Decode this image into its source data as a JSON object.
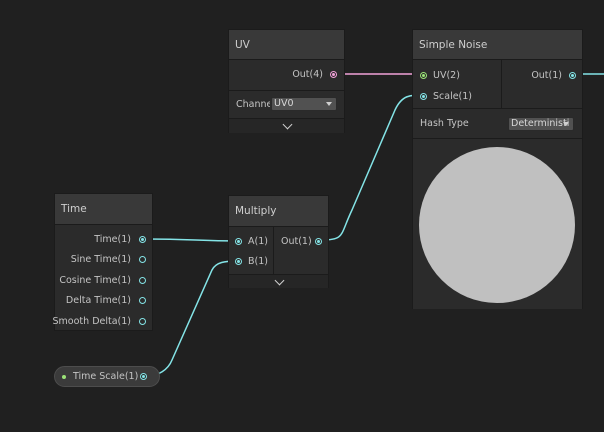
{
  "colors": {
    "background": "#202020",
    "node_body": "#2b2b2b",
    "node_header": "#393939",
    "wire_float": "#84e4e7",
    "wire_vector4": "#f1a1d8",
    "wire_vector2": "#9be378"
  },
  "uv_node": {
    "title": "UV",
    "output_label": "Out(4)",
    "channel_label": "Channe",
    "channel_value": "UV0"
  },
  "simple_noise_node": {
    "title": "Simple Noise",
    "inputs": [
      "UV(2)",
      "Scale(1)"
    ],
    "output_label": "Out(1)",
    "hash_type_label": "Hash Type",
    "hash_type_value": "Deterministi"
  },
  "time_node": {
    "title": "Time",
    "outputs": [
      "Time(1)",
      "Sine Time(1)",
      "Cosine Time(1)",
      "Delta Time(1)",
      "Smooth Delta(1)"
    ]
  },
  "multiply_node": {
    "title": "Multiply",
    "inputs": [
      "A(1)",
      "B(1)"
    ],
    "output_label": "Out(1)"
  },
  "time_scale_property": {
    "label": "Time Scale(1)"
  }
}
